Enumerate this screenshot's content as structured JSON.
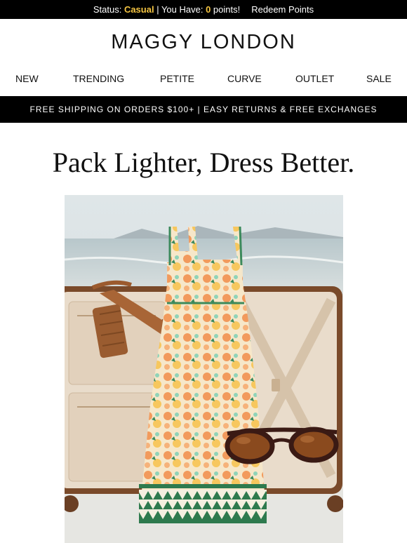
{
  "status_bar": {
    "status_prefix": "Status: ",
    "status_value": "Casual",
    "points_prefix": " | You Have: ",
    "points_value": "0",
    "points_suffix": " points!",
    "redeem_label": "Redeem Points"
  },
  "brand": {
    "logo_text": "MAGGY LONDON"
  },
  "nav": {
    "items": [
      "NEW",
      "TRENDING",
      "PETITE",
      "CURVE",
      "OUTLET",
      "SALE"
    ]
  },
  "promo": {
    "text": "FREE SHIPPING ON ORDERS $100+ | EASY RETURNS & FREE EXCHANGES"
  },
  "main": {
    "headline": "Pack Lighter, Dress Better."
  },
  "colors": {
    "bar_background": "#000000",
    "status_highlight": "#f5c542",
    "suitcase_brown": "#7a4a2a",
    "suitcase_lining": "#e9dccb"
  },
  "icons": {
    "hero": "suitcase-dress-sandal-sunglasses-image"
  }
}
